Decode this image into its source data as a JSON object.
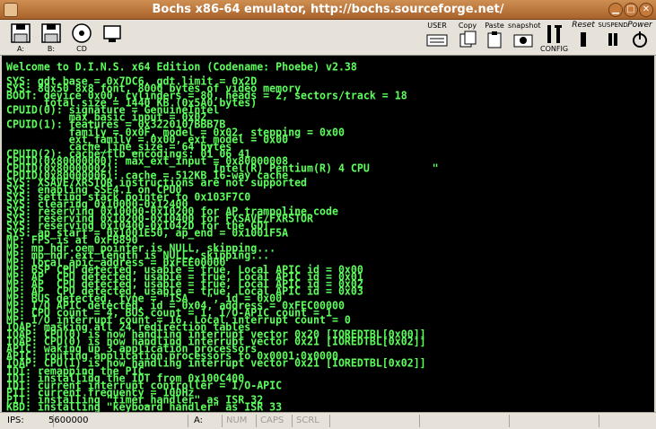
{
  "window": {
    "title": "Bochs x86-64 emulator, http://bochs.sourceforge.net/"
  },
  "toolbar": {
    "left": [
      {
        "name": "floppy-a-icon",
        "label": "A:"
      },
      {
        "name": "floppy-b-icon",
        "label": "B:"
      },
      {
        "name": "cdrom-icon",
        "label": "CD"
      },
      {
        "name": "boot-icon",
        "label": ""
      }
    ],
    "right": {
      "user": "USER",
      "copy": "Copy",
      "paste": "Paste",
      "snapshot": "snapshot",
      "config": "CONFIG",
      "reset": "Reset",
      "suspend": "SUSPEND",
      "power": "Power"
    }
  },
  "console": {
    "lines": [
      "Welcome to D.I.N.S. x64 Edition (Codename: Phoebe) v2.38",
      "",
      "SYS: gdt.base = 0x7DC6, gdt.limit = 0x2D",
      "SYS: 80x50 8x8 font, 8000 bytes of video memory",
      "BOOT: device 0x00, cylinders = 80, heads = 2, sectors/track = 18",
      "      total size = 1440 KB (0x5A0 bytes)",
      "CPUID(0): signature = GenuineIntel",
      "          max_basic_input = 0x02",
      "CPUID(1): features = 0x3220107BBB7B",
      "          family = 0x0F, model = 0x02, stepping = 0x00",
      "          ext_family = 0x00, ext_model = 0x00",
      "          cache_line_size = 64 bytes",
      "CPUID(2): cache/tlb encodings: 01 06 41",
      "CPUID(0x80000000): max_ext_input = 0x80000008",
      "CPUID(0x80000002):               Intel(R) Pentium(R) 4 CPU          \"",
      "CPUID(0x80000006): cache = 512KB 16-way cache",
      "SYS: XSAVE/XRSTOR instructions are not supported",
      "SYS: enabling SSE4.1 on CPU0",
      "SYS: setting stack pointer to 0x103F7C0",
      "SYS: clearing 0x10000-0x12400",
      "SYS: reserving 0x10000-0x10200 for AP trampoline code",
      "SYS: reserving 0x10200-0x10400 for FXSAVE/FXRSTOR",
      "SYS: reserving 0x10400-0x1042D for the GDT",
      "SYS: ap_start = 0x1001E50, ap_end = 0x1001F5A",
      "MP: FPS is at 0xFB890",
      "MP: mp_hdr.oem_pointer is NULL, skipping...",
      "MP: mp_hdr.ext_length is NULL, skipping...",
      "MP: local_apic_address = 0xFEE00000",
      "MP: BSP CPU detected, usable = true, Local APIC id = 0x00",
      "MP: AP  CPU detected, usable = true, Local APIC id = 0x01",
      "MP: AP  CPU detected, usable = true, Local APIC id = 0x02",
      "MP: AP  CPU detected, usable = true, Local APIC id = 0x03",
      "MP: BUS detected, type = \"ISA   \", id = 0x00",
      "MP: I/O APIC detected, id = 0x04, address = 0xFEC00000",
      "MP: CPU count = 4, BUS count = 1, I/O-APIC count = 1",
      "MP: I/O interrupt count = 16, Local interrupt count = 0",
      "IOAP: masking all 24 redirection tables",
      "IOAP: CPU(0) is now handling interrupt vector 0x20 [IOREDTBL[0x00]]",
      "IOAP: CPU(0) is now handling interrupt vector 0x21 [IOREDTBL[0x02]]",
      "APIC: waking up 3 application processors",
      "APIC: routing application processors to 0x0001:0x0000",
      "IOAP: CPU(1) is now handling interrupt vector 0x21 [IOREDTBL[0x02]]",
      "IDT: remapping the PIC",
      "IDT: installing the IDT from 0x100C400",
      "IDT: current interrupt controller = I/O-APIC",
      "PIT: current frequency = 100Hz",
      "PIT: installing \"timer_handler\" as ISR 32",
      "KBD: installing \"keyboard_handler\" as ISR 33"
    ]
  },
  "statusbar": {
    "ips_label": "IPS:",
    "ips_value": "5600000",
    "drive": "A:",
    "num": "NUM",
    "caps": "CAPS",
    "scrl": "SCRL"
  }
}
